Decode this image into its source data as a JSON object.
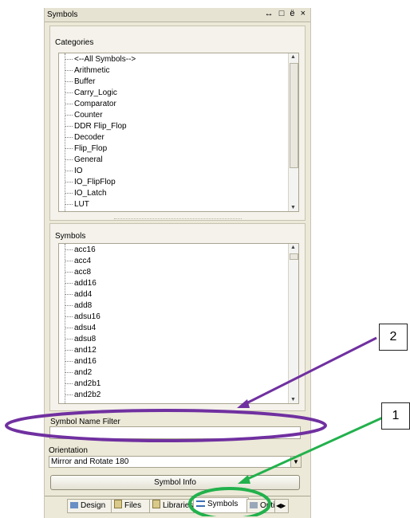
{
  "panel": {
    "title": "Symbols",
    "window_controls": "↔ □ ё ×"
  },
  "categories": {
    "label": "Categories",
    "items": [
      "<--All Symbols-->",
      "Arithmetic",
      "Buffer",
      "Carry_Logic",
      "Comparator",
      "Counter",
      "DDR Flip_Flop",
      "Decoder",
      "Flip_Flop",
      "General",
      "IO",
      "IO_FlipFlop",
      "IO_Latch",
      "LUT"
    ]
  },
  "symbols": {
    "label": "Symbols",
    "items": [
      "acc16",
      "acc4",
      "acc8",
      "add16",
      "add4",
      "add8",
      "adsu16",
      "adsu4",
      "adsu8",
      "and12",
      "and16",
      "and2",
      "and2b1",
      "and2b2"
    ]
  },
  "filter": {
    "label": "Symbol Name Filter",
    "value": ""
  },
  "orientation": {
    "label": "Orientation",
    "value": "Mirror and Rotate 180"
  },
  "symbol_info_button": "Symbol Info",
  "tabs": [
    {
      "label": "Design"
    },
    {
      "label": "Files"
    },
    {
      "label": "Libraries"
    },
    {
      "label": "Symbols"
    },
    {
      "label": "Opti"
    }
  ],
  "callouts": {
    "one": "1",
    "two": "2"
  },
  "colors": {
    "annotation_purple": "#7030a0",
    "annotation_green": "#22b14c"
  }
}
